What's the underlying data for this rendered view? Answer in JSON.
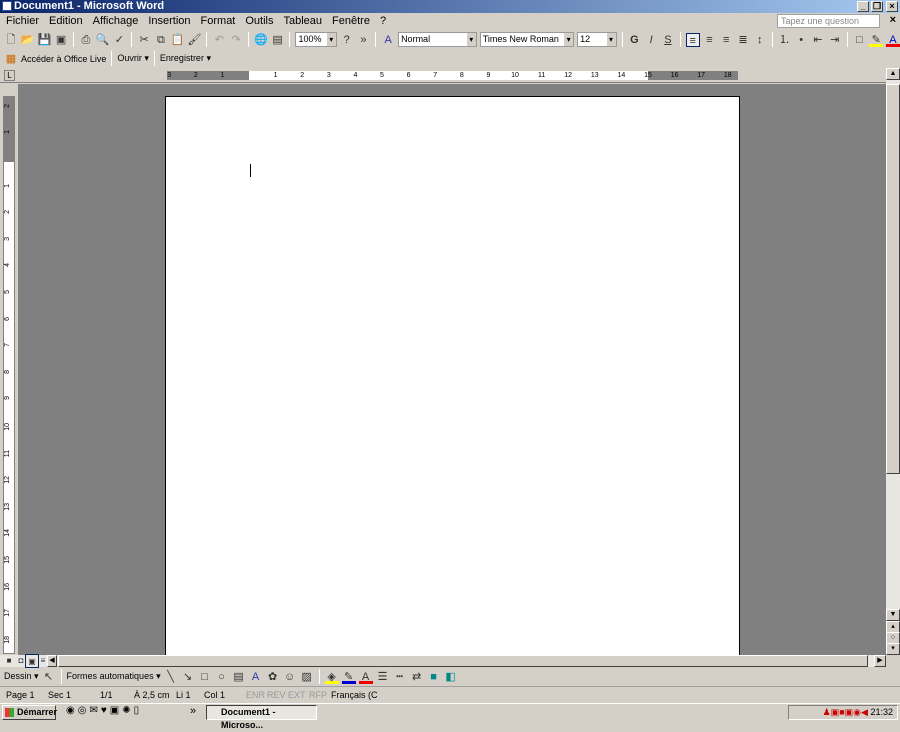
{
  "title": "Document1 - Microsoft Word",
  "menu": [
    "Fichier",
    "Edition",
    "Affichage",
    "Insertion",
    "Format",
    "Outils",
    "Tableau",
    "Fenêtre",
    "?"
  ],
  "ask_placeholder": "Tapez une question",
  "standard": {
    "zoom": "100%",
    "style": "Normal",
    "font": "Times New Roman",
    "size": "12",
    "bold": "G",
    "italic": "I",
    "underline": "S"
  },
  "officelive": {
    "access": "Accéder à Office Live",
    "open": "Ouvrir ▾",
    "save": "Enregistrer ▾"
  },
  "hruler": {
    "left_gray": [
      "3",
      "2",
      "1"
    ],
    "white": [
      "1",
      "2",
      "3",
      "4",
      "5",
      "6",
      "7",
      "8",
      "9",
      "10",
      "11",
      "12",
      "13",
      "14",
      "15"
    ],
    "right_gray": [
      "16",
      "17",
      "18"
    ]
  },
  "vruler": {
    "gray": [
      "2",
      "1"
    ],
    "white": [
      "1",
      "2",
      "3",
      "4",
      "5",
      "6",
      "7",
      "8",
      "9",
      "10",
      "11",
      "12",
      "13",
      "14",
      "15",
      "16",
      "17",
      "18"
    ]
  },
  "drawing": {
    "draw": "Dessin ▾",
    "autoshapes": "Formes automatiques ▾"
  },
  "status": {
    "page": "Page 1",
    "sec": "Sec 1",
    "pages": "1/1",
    "at": "À 2,5 cm",
    "line": "Li 1",
    "col": "Col 1",
    "enr": "ENR",
    "rev": "REV",
    "ext": "EXT",
    "rfp": "RFP",
    "lang": "Français (C"
  },
  "taskbar": {
    "start": "Démarrer",
    "task": "Document1 - Microso...",
    "clock": "21:32"
  }
}
